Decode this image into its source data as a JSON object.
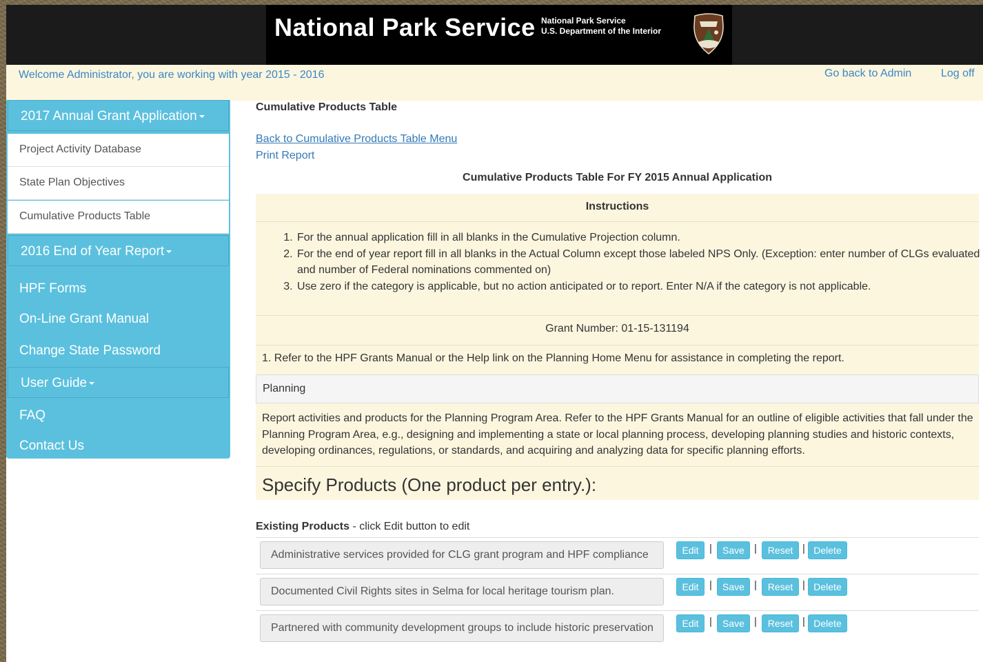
{
  "header": {
    "title": "National Park Service",
    "subtitle_line1": "National Park Service",
    "subtitle_line2": "U.S. Department of the Interior",
    "emblem_icon": "nps-arrowhead-icon"
  },
  "welcome": {
    "text": "Welcome Administrator, you are working with year 2015 - 2016",
    "admin_link": "Go back to Admin",
    "logoff_link": "Log off"
  },
  "sidebar": {
    "menu1_label": "2017 Annual Grant Application",
    "menu1_items": [
      "Project Activity Database",
      "State Plan Objectives",
      "Cumulative Products Table"
    ],
    "menu2_label": "2016 End of Year Report",
    "links1": [
      "HPF Forms",
      "On-Line Grant Manual",
      "Change State Password"
    ],
    "menu3_label": "User Guide",
    "links2": [
      "FAQ",
      "Contact Us"
    ]
  },
  "main": {
    "section_title": "Cumulative Products Table",
    "back_link": "Back to Cumulative Products Table Menu",
    "print_link": "Print Report",
    "center_title": "Cumulative Products Table For FY 2015 Annual Application",
    "instructions_heading": "Instructions",
    "instructions": [
      "For the annual application fill in all blanks in the Cumulative Projection column.",
      "For the end of year report fill in all blanks in the Actual Column except those labeled NPS Only. (Exception: enter number of CLGs evaluated and number of Federal nominations commented on)",
      "Use zero if the category is applicable, but no action anticipated or to report. Enter N/A if the category is not applicable."
    ],
    "grant_number": "Grant Number: 01-15-131194",
    "refer_text": "1. Refer to the HPF Grants Manual or the Help link on the Planning Home Menu for assistance in completing the report.",
    "planning_label": "Planning",
    "report_text": "Report activities and products for the Planning Program Area. Refer to the HPF Grants Manual for an outline of eligible activities that fall under the Planning Program Area, e.g., designing and implementing a state or local planning process, developing planning studies and historic contexts, developing ordinances, regulations, or standards, and acquiring and analyzing data for specific planning efforts.",
    "specify_heading": "Specify Products (One product per entry.):",
    "existing_label": "Existing Products",
    "existing_hint": " - click Edit button to edit",
    "products": [
      "Administrative services provided for CLG grant program and HPF compliance",
      "Documented Civil Rights sites in Selma for local heritage tourism plan.",
      "Partnered with community development groups to include historic preservation"
    ],
    "buttons": {
      "edit": "Edit",
      "save": "Save",
      "reset": "Reset",
      "delete": "Delete",
      "separator": "|"
    }
  }
}
